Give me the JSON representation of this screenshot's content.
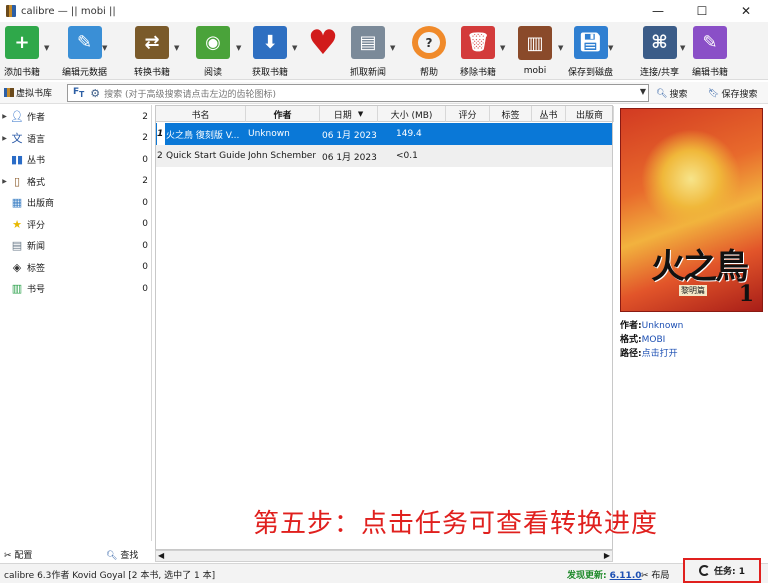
{
  "window": {
    "title": "calibre — || mobi ||",
    "min": "—",
    "max": "☐",
    "close": "✕"
  },
  "toolbar": [
    {
      "id": "add",
      "label": "添加书籍",
      "icon": "add-books-icon",
      "color": "#2fa84a"
    },
    {
      "id": "edit",
      "label": "编辑元数据",
      "icon": "edit-metadata-icon",
      "color": "#3a8fd6"
    },
    {
      "id": "convert",
      "label": "转换书籍",
      "icon": "convert-books-icon",
      "color": "#7a5a2a"
    },
    {
      "id": "view",
      "label": "阅读",
      "icon": "view-icon",
      "color": "#4aa33a"
    },
    {
      "id": "fetch",
      "label": "获取书籍",
      "icon": "get-books-icon",
      "color": "#2e6fc1"
    },
    {
      "id": "donate",
      "label": "",
      "icon": "heart-icon",
      "color": "#d11b1b"
    },
    {
      "id": "news",
      "label": "抓取新闻",
      "icon": "news-icon",
      "color": "#7b8a99"
    },
    {
      "id": "help",
      "label": "帮助",
      "icon": "help-lifebuoy-icon",
      "color": "#f08a2a"
    },
    {
      "id": "remove",
      "label": "移除书籍",
      "icon": "remove-books-icon",
      "color": "#d33b3b"
    },
    {
      "id": "library",
      "label": "mobi",
      "icon": "library-icon",
      "color": "#8a4a2a"
    },
    {
      "id": "device",
      "label": "保存到磁盘",
      "icon": "save-to-disk-icon",
      "color": "#2f7fd1"
    },
    {
      "id": "connect",
      "label": "连接/共享",
      "icon": "connect-share-icon",
      "color": "#3b5c88"
    },
    {
      "id": "editbook",
      "label": "编辑书籍",
      "icon": "edit-book-icon",
      "color": "#8a4fc7"
    }
  ],
  "searchbar": {
    "vlib_label": "虚拟书库",
    "placeholder": "搜索 (对于高级搜索请点击左边的齿轮图标)",
    "search_button": "搜索",
    "save_search_button": "保存搜索"
  },
  "categories": [
    {
      "name": "作者",
      "count": "2",
      "icon": "person-icon",
      "expandable": true
    },
    {
      "name": "语言",
      "count": "2",
      "icon": "language-icon",
      "expandable": true
    },
    {
      "name": "丛书",
      "count": "0",
      "icon": "series-icon",
      "expandable": false
    },
    {
      "name": "格式",
      "count": "2",
      "icon": "format-icon",
      "expandable": true
    },
    {
      "name": "出版商",
      "count": "0",
      "icon": "publisher-icon",
      "expandable": false
    },
    {
      "name": "评分",
      "count": "0",
      "icon": "star-icon",
      "expandable": false
    },
    {
      "name": "新闻",
      "count": "0",
      "icon": "news-icon",
      "expandable": false
    },
    {
      "name": "标签",
      "count": "0",
      "icon": "tag-icon",
      "expandable": false
    },
    {
      "name": "书号",
      "count": "0",
      "icon": "barcode-icon",
      "expandable": false
    }
  ],
  "leftpanel_bottom": {
    "configure": "配置",
    "find": "查找"
  },
  "table": {
    "columns": [
      "书名",
      "作者",
      "日期",
      "大小 (MB)",
      "评分",
      "标签",
      "丛书",
      "出版商"
    ],
    "rows": [
      {
        "num": "1",
        "title": "火之鳥 復刻版 V...",
        "author": "Unknown",
        "date": "06 1月 2023",
        "size": "149.4",
        "selected": true
      },
      {
        "num": "2",
        "title": "Quick Start Guide",
        "author": "John Schember",
        "date": "06 1月 2023",
        "size": "<0.1",
        "selected": false
      }
    ]
  },
  "cover": {
    "title": "火之鳥",
    "subtitle": "黎明篇",
    "volume": "1"
  },
  "details": {
    "author_label": "作者:",
    "author_value": "Unknown",
    "format_label": "格式:",
    "format_value": "MOBI",
    "path_label": "路径:",
    "path_value": "点击打开"
  },
  "caption": "第五步：点击任务可查看转换进度",
  "status": {
    "left": "calibre 6.3作者 Kovid Goyal   [2 本书, 选中了 1 本]",
    "update_label": "发现更新:",
    "update_version": "6.11.0",
    "layout": "布局",
    "jobs": "任务:  1"
  }
}
